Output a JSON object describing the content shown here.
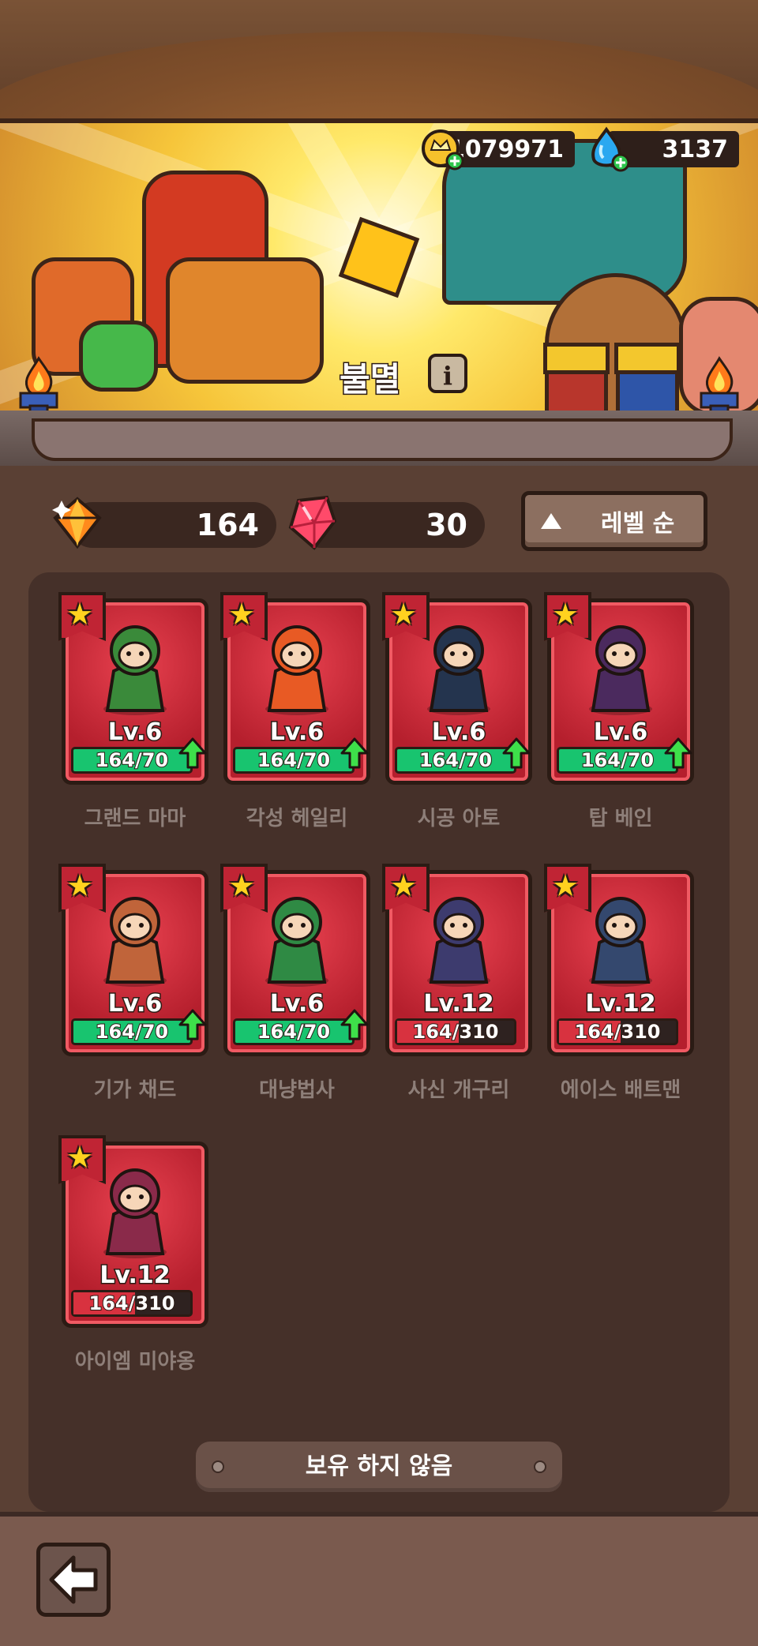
{
  "currencies": {
    "gold": {
      "value": "1079971",
      "icon": "crown-coin-icon"
    },
    "gems": {
      "value": "3137",
      "icon": "blue-gem-icon"
    }
  },
  "banner": {
    "title": "불멸",
    "info_label": "i"
  },
  "shards": {
    "orange": {
      "value": "164",
      "icon": "orange-gem-icon"
    },
    "pink": {
      "value": "30",
      "icon": "pink-crystal-icon"
    }
  },
  "sort": {
    "label": "레벨 순",
    "icon": "triangle-up-icon"
  },
  "heroes": [
    {
      "name": "그랜드 마마",
      "level": "Lv.6",
      "progress": "164/70",
      "can_upgrade": true,
      "color": "#3a8a3a"
    },
    {
      "name": "각성 헤일리",
      "level": "Lv.6",
      "progress": "164/70",
      "can_upgrade": true,
      "color": "#e85a24"
    },
    {
      "name": "시공 아토",
      "level": "Lv.6",
      "progress": "164/70",
      "can_upgrade": true,
      "color": "#24344e"
    },
    {
      "name": "탑 베인",
      "level": "Lv.6",
      "progress": "164/70",
      "can_upgrade": true,
      "color": "#4b2a5e"
    },
    {
      "name": "기가 채드",
      "level": "Lv.6",
      "progress": "164/70",
      "can_upgrade": true,
      "color": "#c0643a"
    },
    {
      "name": "대냥법사",
      "level": "Lv.6",
      "progress": "164/70",
      "can_upgrade": true,
      "color": "#2f8a44"
    },
    {
      "name": "사신 개구리",
      "level": "Lv.12",
      "progress": "164/310",
      "can_upgrade": false,
      "color": "#3d3b6e"
    },
    {
      "name": "에이스 배트맨",
      "level": "Lv.12",
      "progress": "164/310",
      "can_upgrade": false,
      "color": "#34486e"
    },
    {
      "name": "아이엠 미야옹",
      "level": "Lv.12",
      "progress": "164/310",
      "can_upgrade": false,
      "color": "#8a2a4a"
    }
  ],
  "not_owned_label": "보유 하지 않음",
  "back_icon": "back-arrow-icon"
}
